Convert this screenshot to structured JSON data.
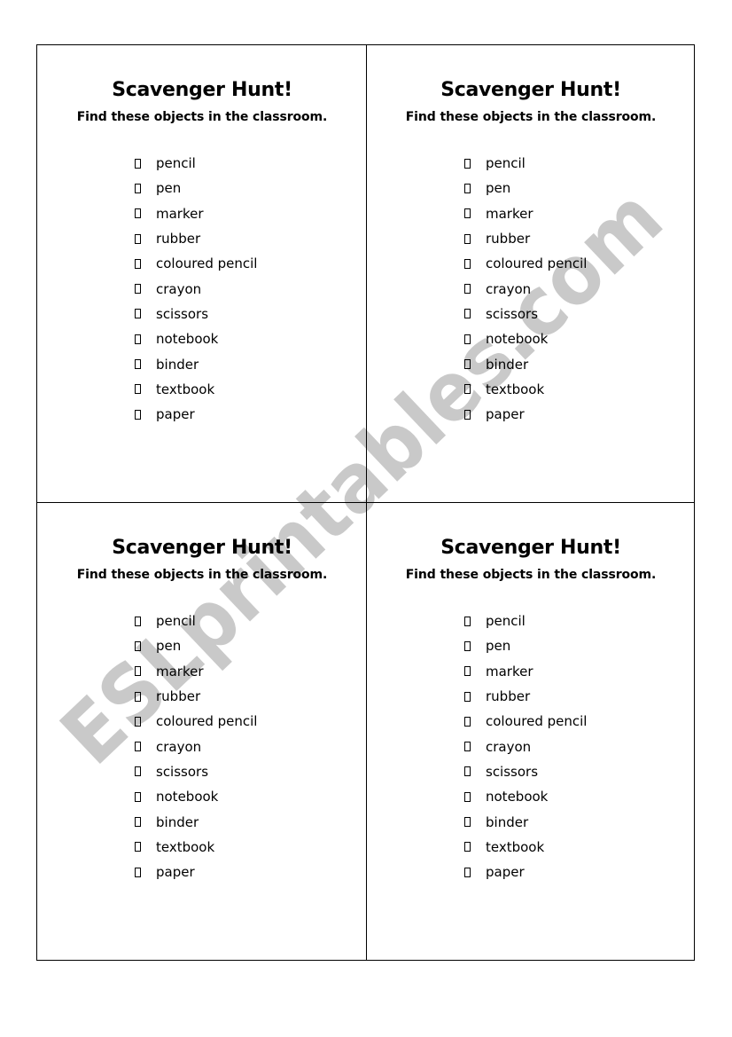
{
  "watermark": {
    "text": "ESLprintables.com",
    "color": "#c9c9c9"
  },
  "cards": [
    {
      "title": "Scavenger Hunt!",
      "subtitle": "Find these objects in the classroom.",
      "items": [
        "pencil",
        "pen",
        "marker",
        "rubber",
        "coloured pencil",
        "crayon",
        "scissors",
        "notebook",
        "binder",
        "textbook",
        "paper"
      ]
    },
    {
      "title": "Scavenger Hunt!",
      "subtitle": "Find these objects in the classroom.",
      "items": [
        "pencil",
        "pen",
        "marker",
        "rubber",
        "coloured pencil",
        "crayon",
        "scissors",
        "notebook",
        "binder",
        "textbook",
        "paper"
      ]
    },
    {
      "title": "Scavenger Hunt!",
      "subtitle": "Find these objects in the classroom.",
      "items": [
        "pencil",
        "pen",
        "marker",
        "rubber",
        "coloured pencil",
        "crayon",
        "scissors",
        "notebook",
        "binder",
        "textbook",
        "paper"
      ]
    },
    {
      "title": "Scavenger Hunt!",
      "subtitle": "Find these objects in the classroom.",
      "items": [
        "pencil",
        "pen",
        "marker",
        "rubber",
        "coloured pencil",
        "crayon",
        "scissors",
        "notebook",
        "binder",
        "textbook",
        "paper"
      ]
    }
  ]
}
